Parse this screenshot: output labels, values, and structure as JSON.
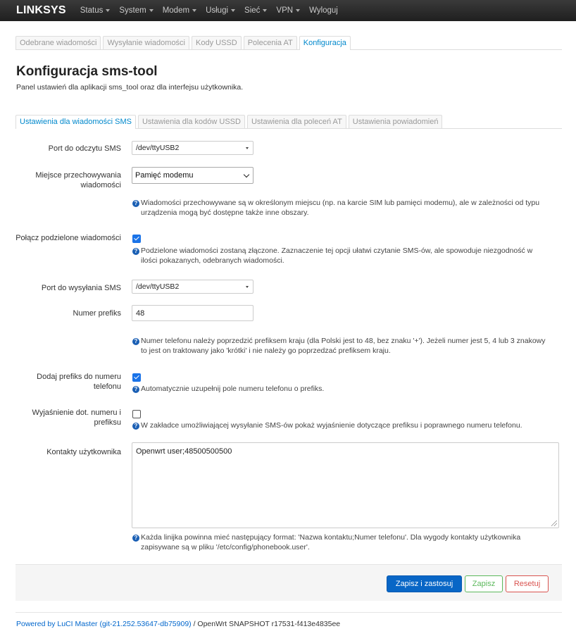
{
  "navbar": {
    "brand": "LINKSYS",
    "items": [
      {
        "label": "Status"
      },
      {
        "label": "System"
      },
      {
        "label": "Modem"
      },
      {
        "label": "Usługi"
      },
      {
        "label": "Sieć"
      },
      {
        "label": "VPN"
      },
      {
        "label": "Wyloguj"
      }
    ]
  },
  "top_tabs": [
    {
      "label": "Odebrane wiadomości"
    },
    {
      "label": "Wysyłanie wiadomości"
    },
    {
      "label": "Kody USSD"
    },
    {
      "label": "Polecenia AT"
    },
    {
      "label": "Konfiguracja"
    }
  ],
  "page": {
    "title": "Konfiguracja sms-tool",
    "description": "Panel ustawień dla aplikacji sms_tool oraz dla interfejsu użytkownika."
  },
  "sub_tabs": [
    {
      "label": "Ustawienia dla wiadomości SMS"
    },
    {
      "label": "Ustawienia dla kodów USSD"
    },
    {
      "label": "Ustawienia dla poleceń AT"
    },
    {
      "label": "Ustawienia powiadomień"
    }
  ],
  "form": {
    "read_port": {
      "label": "Port do odczytu SMS",
      "value": "/dev/ttyUSB2"
    },
    "storage": {
      "label_line1": "Miejsce przechowywania",
      "label_line2": "wiadomości",
      "value": "Pamięć modemu",
      "help_line1": "Wiadomości przechowywane są w określonym miejscu (np. na karcie SIM lub pamięci modemu), ale w zależności od typu",
      "help_line2": "urządzenia mogą być dostępne także inne obszary."
    },
    "merge": {
      "label": "Połącz podzielone wiadomości",
      "checked": true,
      "help_line1": "Podzielone wiadomości zostaną złączone. Zaznaczenie tej opcji ułatwi czytanie SMS-ów, ale spowoduje niezgodność w",
      "help_line2": "ilości pokazanych, odebranych wiadomości."
    },
    "send_port": {
      "label": "Port do wysyłania SMS",
      "value": "/dev/ttyUSB2"
    },
    "prefix": {
      "label": "Numer prefiks",
      "value": "48",
      "help_line1": "Numer telefonu należy poprzedzić prefiksem kraju (dla Polski jest to 48, bez znaku '+'). Jeżeli numer jest 5, 4 lub 3 znakowy",
      "help_line2": "to jest on traktowany jako 'krótki' i nie należy go poprzedzać prefiksem kraju."
    },
    "add_prefix": {
      "label_line1": "Dodaj prefiks do numeru",
      "label_line2": "telefonu",
      "checked": true,
      "help": "Automatycznie uzupełnij pole numeru telefonu o prefiks."
    },
    "prefix_info": {
      "label_line1": "Wyjaśnienie dot. numeru i",
      "label_line2": "prefiksu",
      "checked": false,
      "help": "W zakładce umożliwiającej wysyłanie SMS-ów pokaż wyjaśnienie dotyczące prefiksu i poprawnego numeru telefonu."
    },
    "contacts": {
      "label": "Kontakty użytkownika",
      "value": "Openwrt user;48500500500",
      "help_line1": "Każda linijka powinna mieć następujący format: 'Nazwa kontaktu;Numer telefonu'. Dla wygody kontakty użytkownika",
      "help_line2": "zapisywane są w pliku '/etc/config/phonebook.user'."
    }
  },
  "actions": {
    "apply": "Zapisz i zastosuj",
    "save": "Zapisz",
    "reset": "Resetuj"
  },
  "footer": {
    "link": "Powered by LuCI Master (git-21.252.53647-db75909)",
    "text": " / OpenWrt SNAPSHOT r17531-f413e4835ee"
  },
  "colors": {
    "accent": "#0088cc",
    "apply_button": "#0866c6",
    "save_button": "#5cb85c",
    "reset_button": "#d9534f",
    "checkbox": "#1a73e8"
  }
}
